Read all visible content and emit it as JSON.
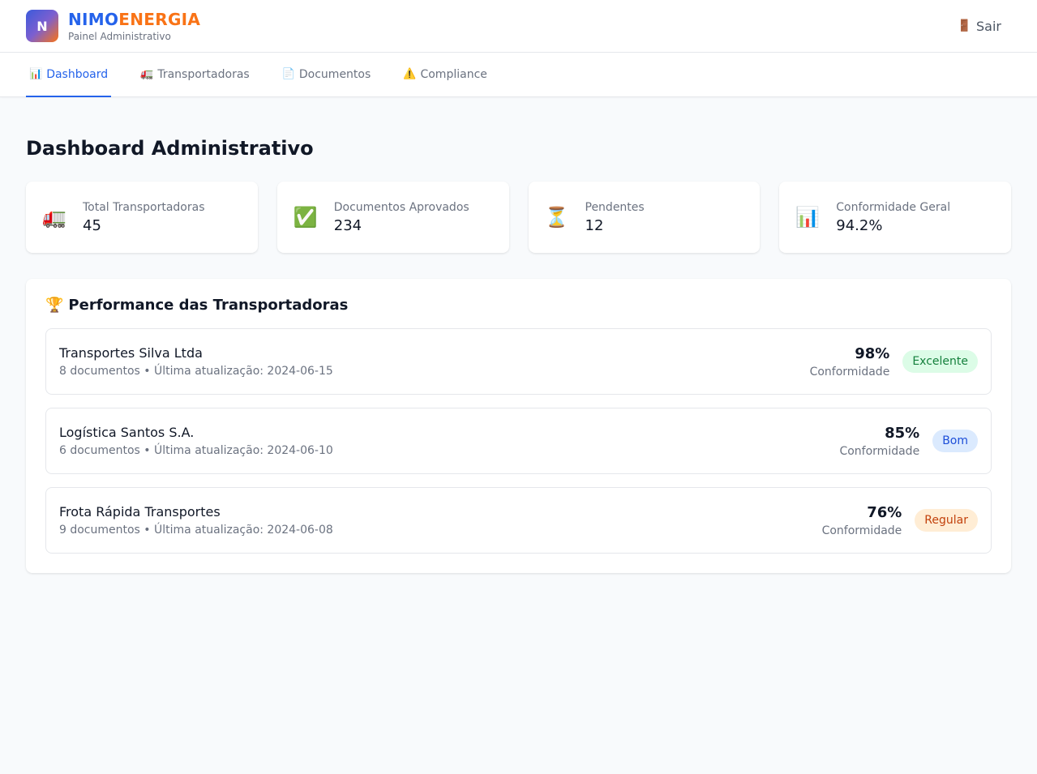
{
  "header": {
    "logo_letter": "N",
    "brand_part1": "NIMO",
    "brand_part2": "ENERGIA",
    "subtitle": "Painel Administrativo",
    "logout_icon": "🚪",
    "logout_label": "Sair"
  },
  "tabs": [
    {
      "icon": "📊",
      "label": "Dashboard",
      "active": true
    },
    {
      "icon": "🚛",
      "label": "Transportadoras",
      "active": false
    },
    {
      "icon": "📄",
      "label": "Documentos",
      "active": false
    },
    {
      "icon": "⚠️",
      "label": "Compliance",
      "active": false
    }
  ],
  "page_title": "Dashboard Administrativo",
  "stats": [
    {
      "icon": "🚛",
      "label": "Total Transportadoras",
      "value": "45"
    },
    {
      "icon": "✅",
      "label": "Documentos Aprovados",
      "value": "234"
    },
    {
      "icon": "⏳",
      "label": "Pendentes",
      "value": "12"
    },
    {
      "icon": "📊",
      "label": "Conformidade Geral",
      "value": "94.2%"
    }
  ],
  "performance": {
    "icon": "🏆",
    "title": "Performance das Transportadoras",
    "rows": [
      {
        "name": "Transportes Silva Ltda",
        "meta": "8 documentos • Última atualização: 2024-06-15",
        "score": "98%",
        "score_label": "Conformidade",
        "badge": "Excelente",
        "badge_color": "#15803d"
      },
      {
        "name": "Logística Santos S.A.",
        "meta": "6 documentos • Última atualização: 2024-06-10",
        "score": "85%",
        "score_label": "Conformidade",
        "badge": "Bom",
        "badge_color": "#1d4ed8"
      },
      {
        "name": "Frota Rápida Transportes",
        "meta": "9 documentos • Última atualização: 2024-06-08",
        "score": "76%",
        "score_label": "Conformidade",
        "badge": "Regular",
        "badge_color": "#c2410c"
      }
    ]
  }
}
